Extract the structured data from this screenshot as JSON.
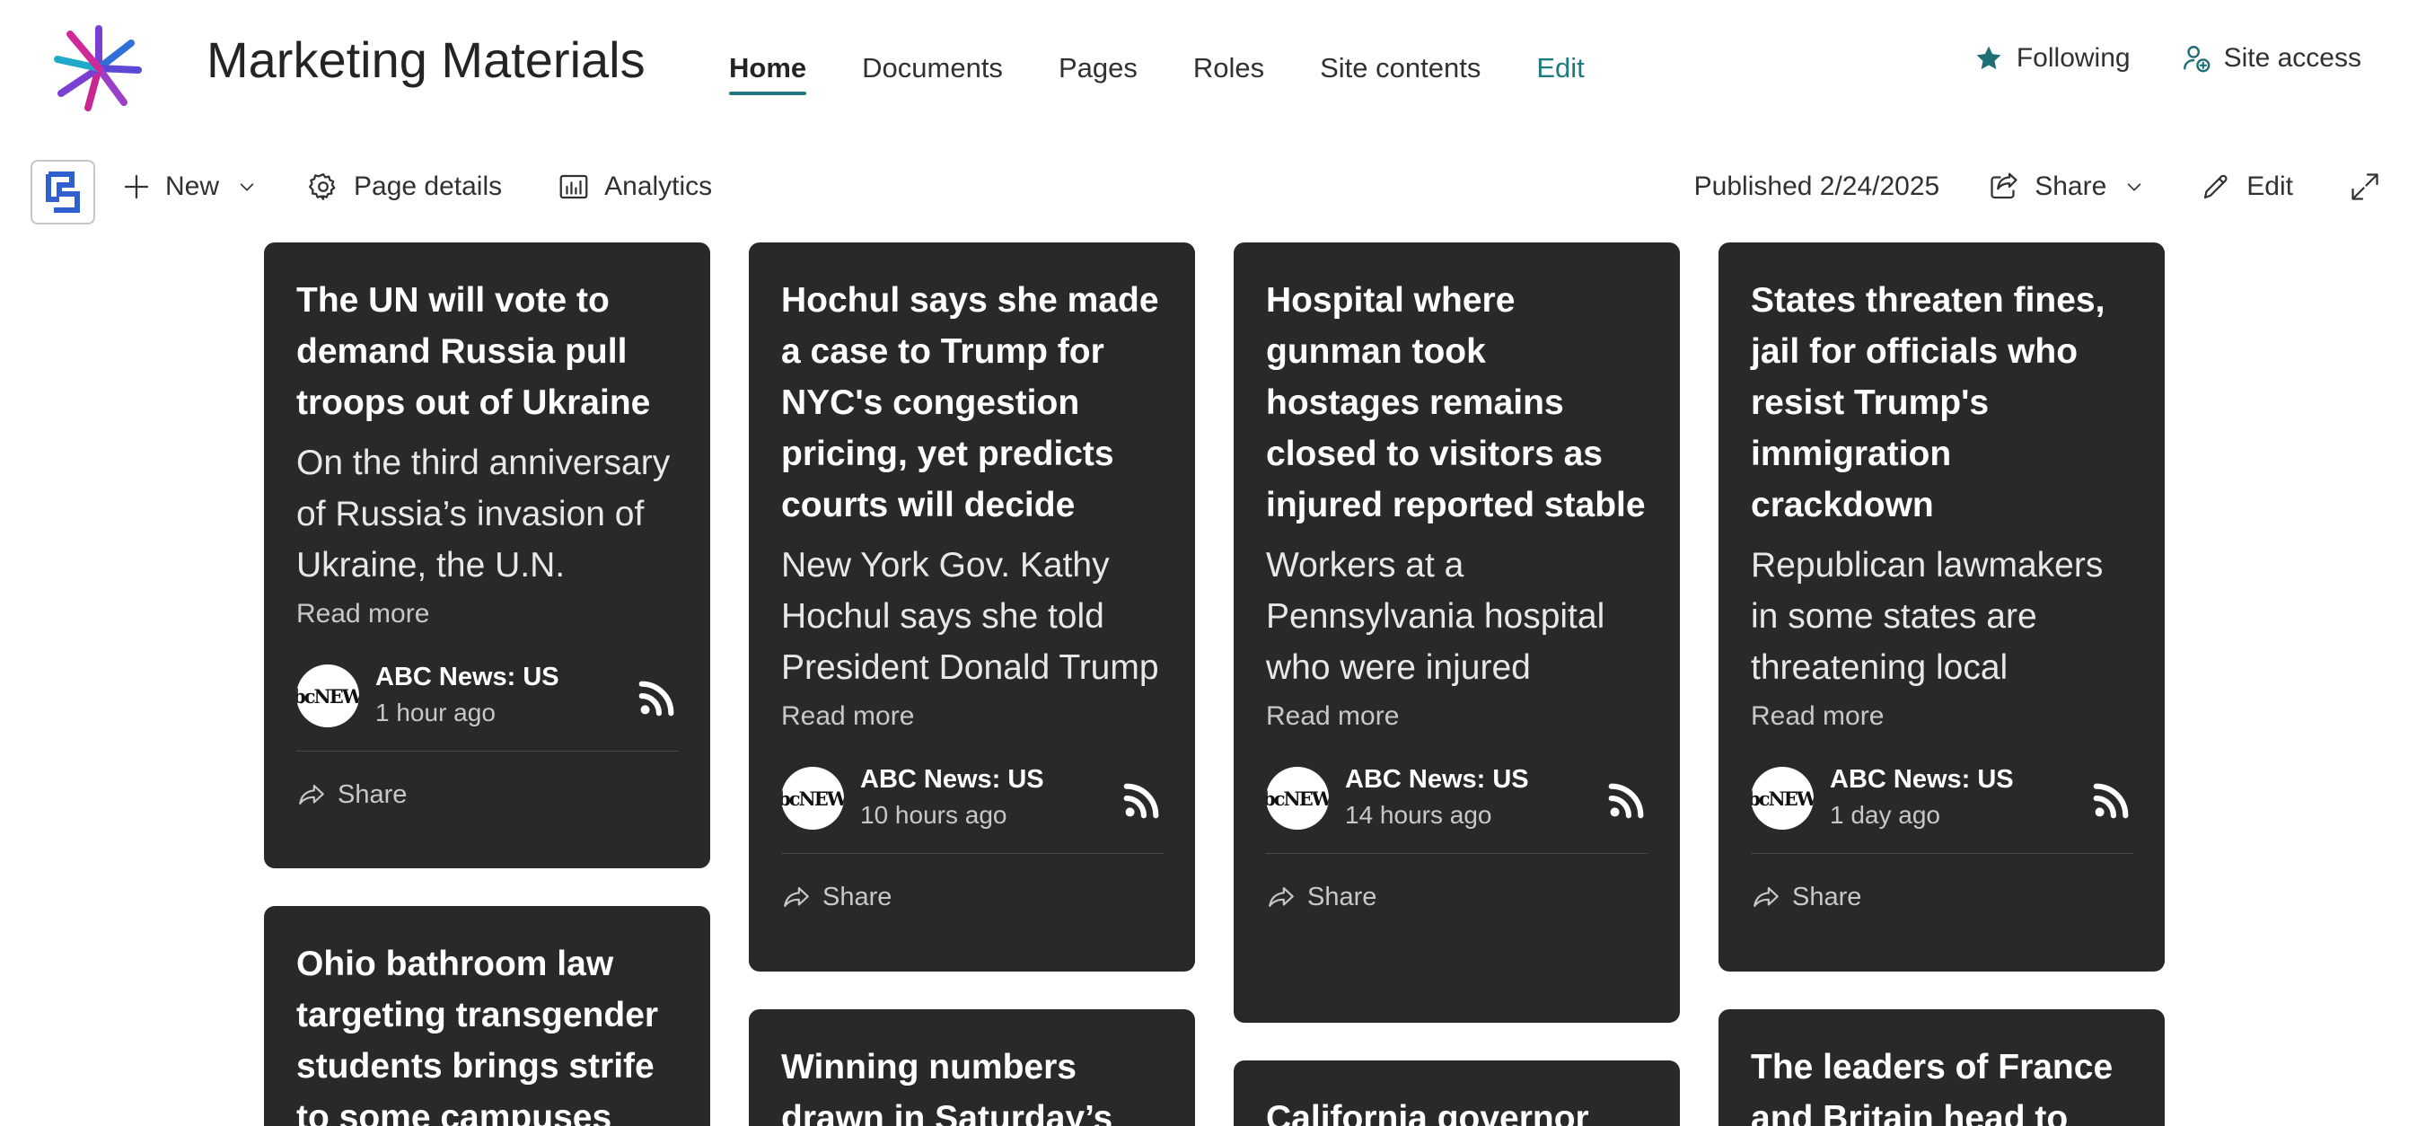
{
  "site": {
    "title": "Marketing Materials",
    "accent": "#1f7a80"
  },
  "nav": {
    "items": [
      {
        "label": "Home",
        "active": true
      },
      {
        "label": "Documents"
      },
      {
        "label": "Pages"
      },
      {
        "label": "Roles"
      },
      {
        "label": "Site contents"
      },
      {
        "label": "Edit",
        "accent": true
      }
    ]
  },
  "header_actions": {
    "following": {
      "label": "Following",
      "icon": "star-icon"
    },
    "site_access": {
      "label": "Site access",
      "icon": "person-add-icon"
    }
  },
  "command_bar": {
    "new": {
      "label": "New",
      "icon": "plus-icon"
    },
    "page_details": {
      "label": "Page details",
      "icon": "gear-icon"
    },
    "analytics": {
      "label": "Analytics",
      "icon": "analytics-icon"
    },
    "published": "Published 2/24/2025",
    "share": {
      "label": "Share",
      "icon": "share-icon"
    },
    "edit": {
      "label": "Edit",
      "icon": "pencil-icon"
    },
    "expand": {
      "icon": "expand-icon"
    }
  },
  "cards": [
    {
      "title": "The UN will vote to demand Russia pull troops out of Ukraine",
      "description": "On the third anniversary of Russia’s invasion of Ukraine, the U.N.",
      "read_more": "Read more",
      "source": "ABC News: US",
      "logo_text": "abcNEWS",
      "time": "1 hour ago",
      "share": "Share"
    },
    {
      "title": "Hochul says she made a case to Trump for NYC's congestion pricing, yet predicts courts will decide",
      "description": "New York Gov. Kathy Hochul says she told President Donald Trump",
      "read_more": "Read more",
      "source": "ABC News: US",
      "logo_text": "abcNEWS",
      "time": "10 hours ago",
      "share": "Share"
    },
    {
      "title": "Hospital where gunman took hostages remains closed to visitors as injured reported stable",
      "description": "Workers at a Pennsylvania hospital who were injured",
      "read_more": "Read more",
      "source": "ABC News: US",
      "logo_text": "abcNEWS",
      "time": "14 hours ago",
      "share": "Share"
    },
    {
      "title": "States threaten fines, jail for officials who resist Trump's immigration crackdown",
      "description": "Republican lawmakers in some states are threatening local",
      "read_more": "Read more",
      "source": "ABC News: US",
      "logo_text": "abcNEWS",
      "time": "1 day ago",
      "share": "Share"
    },
    {
      "title": "Ohio bathroom law targeting transgender students brings strife to some campuses"
    },
    {
      "title": "Winning numbers drawn in Saturday’s"
    },
    {
      "title": "California governor"
    },
    {
      "title": "The leaders of France and Britain head to"
    }
  ]
}
